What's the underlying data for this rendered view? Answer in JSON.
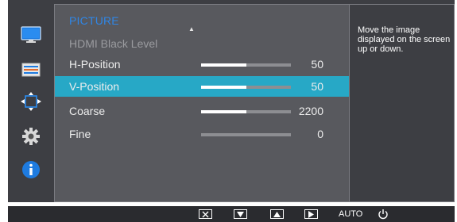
{
  "menu": {
    "title": "PICTURE",
    "items": [
      {
        "label": "HDMI Black Level",
        "value": "",
        "disabled": true,
        "bar": null
      },
      {
        "label": "H-Position",
        "value": "50",
        "bar": 0.5
      },
      {
        "label": "V-Position",
        "value": "50",
        "bar": 0.5,
        "selected": true
      },
      {
        "label": "Coarse",
        "value": "2200",
        "bar": 0.5
      },
      {
        "label": "Fine",
        "value": "0",
        "bar": 0.0
      }
    ]
  },
  "help": {
    "text": "Move the image displayed on the screen up or down."
  },
  "sidebar": {
    "items": [
      {
        "icon": "picture-icon",
        "active": true
      },
      {
        "icon": "onscreen-display-icon"
      },
      {
        "icon": "position-arrows-icon"
      },
      {
        "icon": "settings-gear-icon"
      },
      {
        "icon": "information-icon"
      }
    ]
  },
  "bottom_bar": {
    "buttons": [
      {
        "icon": "close-x-icon"
      },
      {
        "icon": "down-triangle-icon"
      },
      {
        "icon": "up-triangle-icon"
      },
      {
        "icon": "right-triangle-icon"
      },
      {
        "label": "AUTO"
      },
      {
        "icon": "power-icon"
      }
    ]
  },
  "colors": {
    "accent": "#27a8c6",
    "title": "#2f86e6",
    "panel": "#58595e",
    "background": "#3d3e43"
  }
}
